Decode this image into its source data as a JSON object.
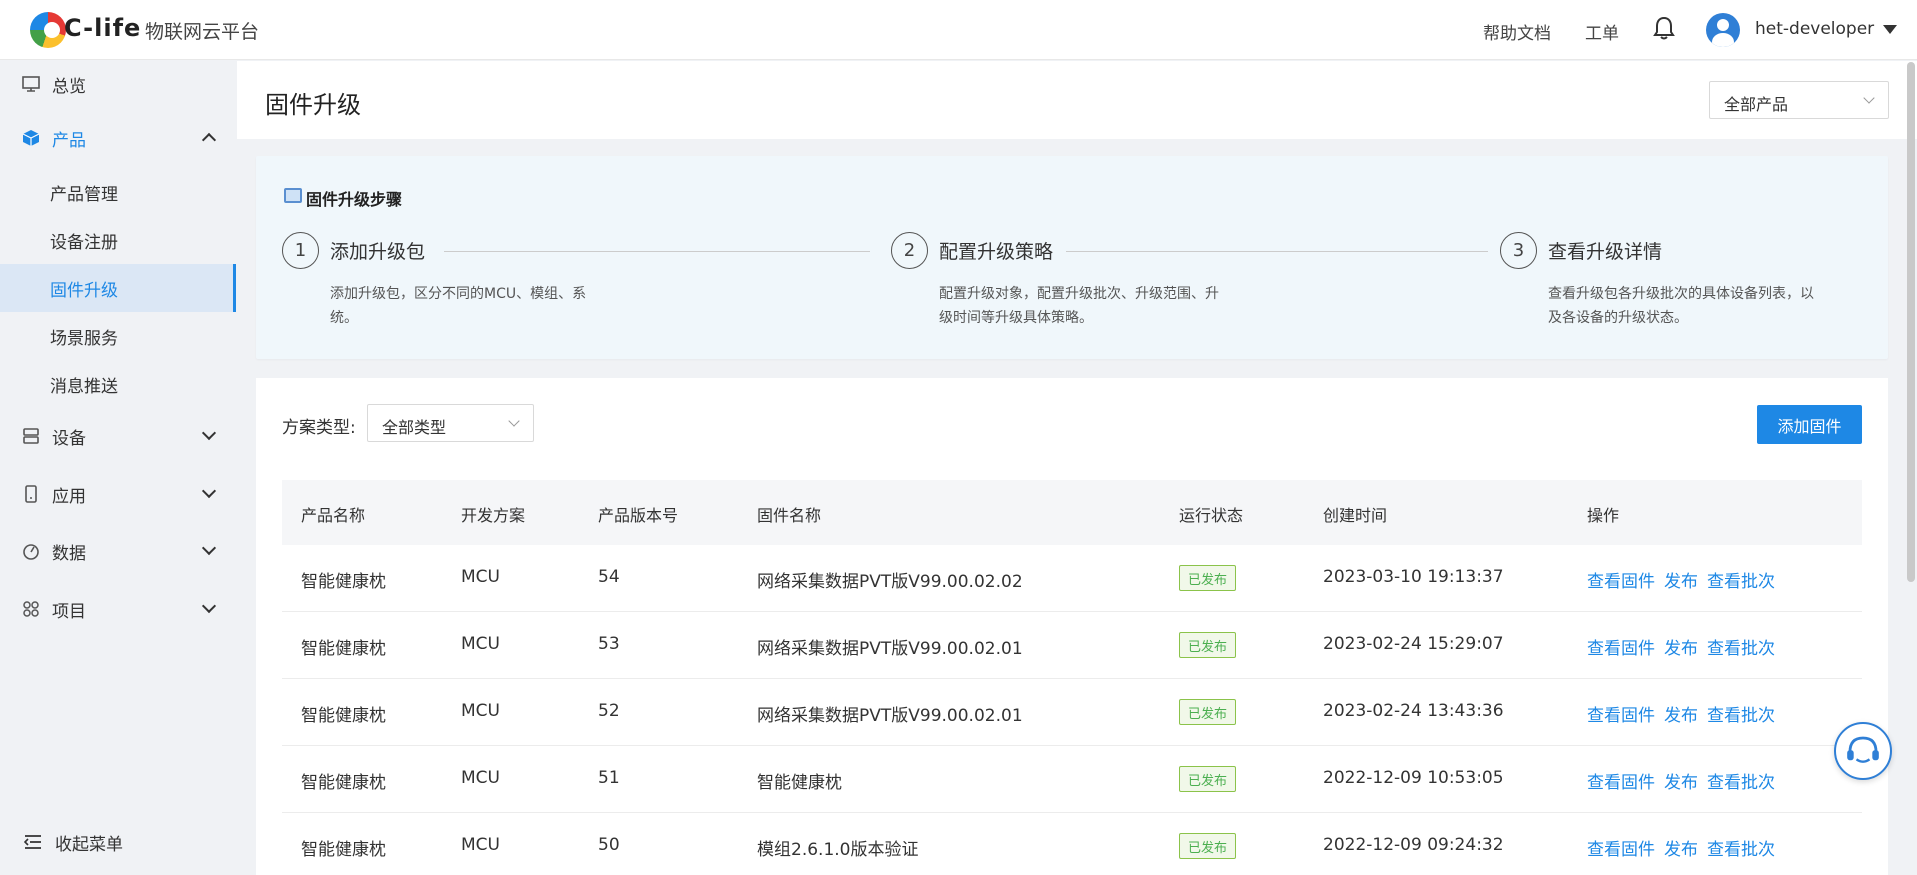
{
  "topbar": {
    "brand": "C-life",
    "platform": "物联网云平台",
    "help_docs": "帮助文档",
    "work_order": "工单",
    "username": "het-developer"
  },
  "sidebar": {
    "items": [
      {
        "label": "总览",
        "icon": "monitor-icon"
      },
      {
        "label": "产品",
        "icon": "cube-icon"
      },
      {
        "label": "设备",
        "icon": "device-icon"
      },
      {
        "label": "应用",
        "icon": "phone-icon"
      },
      {
        "label": "数据",
        "icon": "gauge-icon"
      },
      {
        "label": "项目",
        "icon": "grid-icon"
      }
    ],
    "sub_items": [
      "产品管理",
      "设备注册",
      "固件升级",
      "场景服务",
      "消息推送"
    ],
    "collapse_label": "收起菜单"
  },
  "header": {
    "title": "固件升级",
    "product_filter": "全部产品"
  },
  "steps": {
    "title": "固件升级步骤",
    "items": [
      {
        "num": "1",
        "title": "添加升级包",
        "desc": "添加升级包，区分不同的MCU、模组、系统。"
      },
      {
        "num": "2",
        "title": "配置升级策略",
        "desc": "配置升级对象，配置升级批次、升级范围、升级时间等升级具体策略。"
      },
      {
        "num": "3",
        "title": "查看升级详情",
        "desc": "查看升级包各升级批次的具体设备列表，以及各设备的升级状态。"
      }
    ]
  },
  "filter": {
    "label": "方案类型:",
    "value": "全部类型",
    "add_button": "添加固件"
  },
  "table": {
    "headers": [
      "产品名称",
      "开发方案",
      "产品版本号",
      "固件名称",
      "运行状态",
      "创建时间",
      "操作"
    ],
    "rows": [
      {
        "product": "智能健康枕",
        "scheme": "MCU",
        "version": "54",
        "firmware": "网络采集数据PVT版V99.00.02.02",
        "status": "已发布",
        "created": "2023-03-10 19:13:37"
      },
      {
        "product": "智能健康枕",
        "scheme": "MCU",
        "version": "53",
        "firmware": "网络采集数据PVT版V99.00.02.01",
        "status": "已发布",
        "created": "2023-02-24 15:29:07"
      },
      {
        "product": "智能健康枕",
        "scheme": "MCU",
        "version": "52",
        "firmware": "网络采集数据PVT版V99.00.02.01",
        "status": "已发布",
        "created": "2023-02-24 13:43:36"
      },
      {
        "product": "智能健康枕",
        "scheme": "MCU",
        "version": "51",
        "firmware": "智能健康枕",
        "status": "已发布",
        "created": "2022-12-09 10:53:05"
      },
      {
        "product": "智能健康枕",
        "scheme": "MCU",
        "version": "50",
        "firmware": "模组2.6.1.0版本验证",
        "status": "已发布",
        "created": "2022-12-09 09:24:32"
      }
    ],
    "actions": {
      "view": "查看固件",
      "publish": "发布",
      "batch": "查看批次"
    }
  },
  "colors": {
    "accent": "#1e88e5",
    "status_green": "#4caf50"
  }
}
